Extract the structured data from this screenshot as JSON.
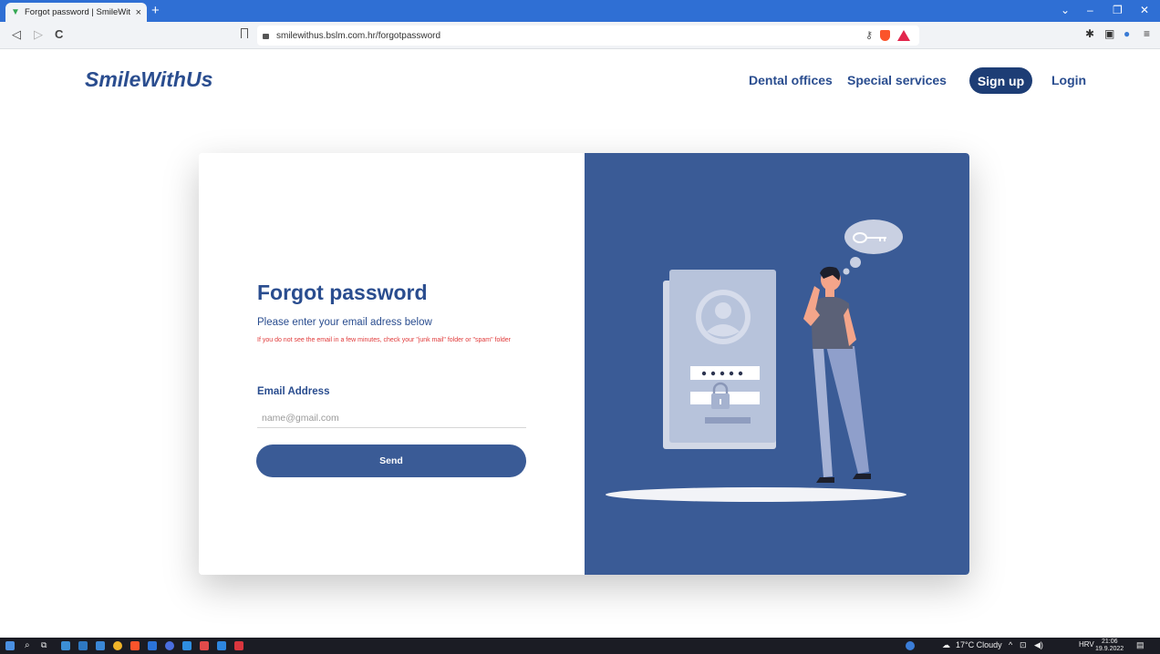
{
  "browser": {
    "tab_title": "Forgot password | SmileWithUs",
    "tab_close": "×",
    "new_tab": "+",
    "url": "smilewithus.bslm.com.hr/forgotpassword"
  },
  "site": {
    "logo": "SmileWithUs",
    "nav": {
      "dental_offices": "Dental offices",
      "special_services": "Special services",
      "sign_up": "Sign up",
      "login": "Login"
    }
  },
  "form": {
    "heading": "Forgot password",
    "subheading": "Please enter your email adress below",
    "warning": "If you do not see the email in a few minutes, check your \"junk mail\" folder or \"spam\" folder",
    "email_label": "Email Address",
    "email_placeholder": "name@gmail.com",
    "email_value": "",
    "send_label": "Send"
  },
  "taskbar": {
    "weather": "17°C Cloudy",
    "language": "HRV",
    "time": "21:06",
    "date": "19.9.2022"
  },
  "colors": {
    "brand": "#2a4d8f",
    "panel": "#3a5b96",
    "signup_bg": "#1d3d75",
    "warning": "#e03a3a"
  }
}
